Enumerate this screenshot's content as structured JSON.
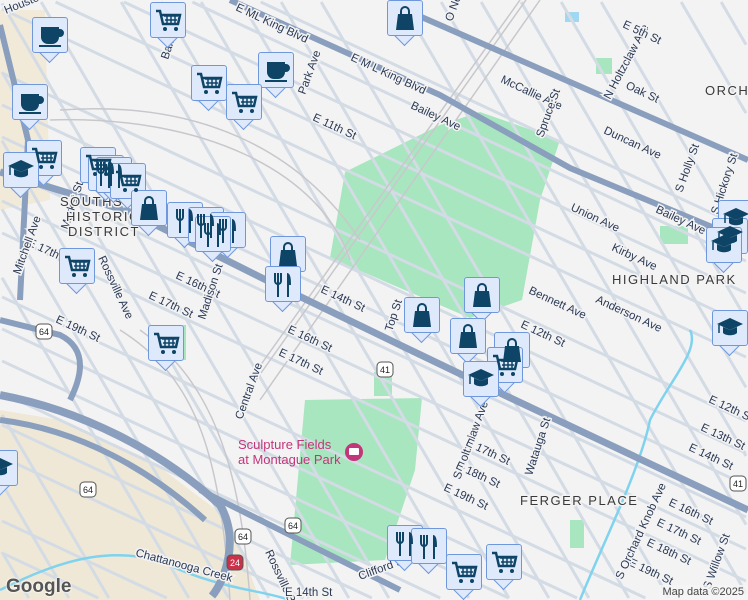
{
  "streets": [
    "Houston St",
    "E ML King Blvd",
    "Baldwin St",
    "Park Ave",
    "E 11th St",
    "E M L King Blvd",
    "Bailey Ave",
    "McCallie Ave",
    "O Neal St",
    "Spruce St",
    "N Holtzclaw Ave",
    "E 5th St",
    "Oak St",
    "Duncan Ave",
    "S Holly St",
    "S Hickory St",
    "Union Ave",
    "Bailey Ave",
    "Kirby Ave",
    "Bennett Ave",
    "Anderson Ave",
    "E 12th St",
    "E 14th St",
    "Top St",
    "Market St",
    "E 17th St",
    "Mitchell Ave",
    "Rossville Ave",
    "E 16th St",
    "E 17th St",
    "E 19th St",
    "Madison St",
    "E 16th St",
    "E 17th St",
    "Central Ave",
    "S Holtzclaw Ave",
    "E 17th St",
    "E 18th St",
    "E 19th St",
    "Wataugа St",
    "E 12th St",
    "E 13th St",
    "E 14th St",
    "E 16th St",
    "E 17th St",
    "E 18th St",
    "E 19th St",
    "S Orchard Knob Ave",
    "S Willow St",
    "Rossville Blvd",
    "Clifford St",
    "Chattanooga Creek",
    "E 14th St"
  ],
  "neighborhoods": [
    "SOUTHSIDE",
    "HISTORIC",
    "DISTRICT",
    "HIGHLAND PARK",
    "ORCHARD",
    "FERGER PLACE"
  ],
  "poi": {
    "line1": "Sculpture Fields",
    "line2": "at Montague Park"
  },
  "shields": [
    "41",
    "41",
    "64",
    "64",
    "64",
    "24",
    "64"
  ],
  "markers": [
    "cup",
    "cart",
    "cup",
    "cart",
    "cup",
    "cart",
    "cart",
    "grad",
    "cart",
    "cutlery",
    "cutlery",
    "cart",
    "bag",
    "cutlery",
    "cutlery",
    "cutlery",
    "cutlery",
    "bag",
    "cutlery",
    "cart",
    "cart",
    "bag",
    "bag",
    "bag",
    "bag",
    "bag",
    "cart",
    "grad",
    "grad",
    "grad",
    "grad",
    "grad",
    "cutlery",
    "cutlery",
    "cart",
    "cart",
    "grad"
  ],
  "attribution": "Map data ©2025",
  "logo": "Google",
  "colors": {
    "park": "#a8e6bf",
    "road": "#8a9fbd",
    "minor": "#d3dbe5",
    "water": "#7fd3ee",
    "marker_icon": "#0e4466"
  }
}
